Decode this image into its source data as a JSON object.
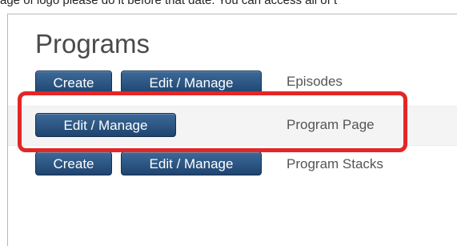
{
  "banner": {
    "text": "age of logo please do it before that date. You can access all of t"
  },
  "programs": {
    "title": "Programs",
    "rows": [
      {
        "create_label": "Create",
        "edit_label": "Edit / Manage",
        "label": "Episodes"
      },
      {
        "edit_label": "Edit / Manage",
        "label": "Program Page"
      },
      {
        "create_label": "Create",
        "edit_label": "Edit / Manage",
        "label": "Program Stacks"
      }
    ]
  },
  "colors": {
    "button": "#1f4470",
    "highlight": "#e32626"
  }
}
